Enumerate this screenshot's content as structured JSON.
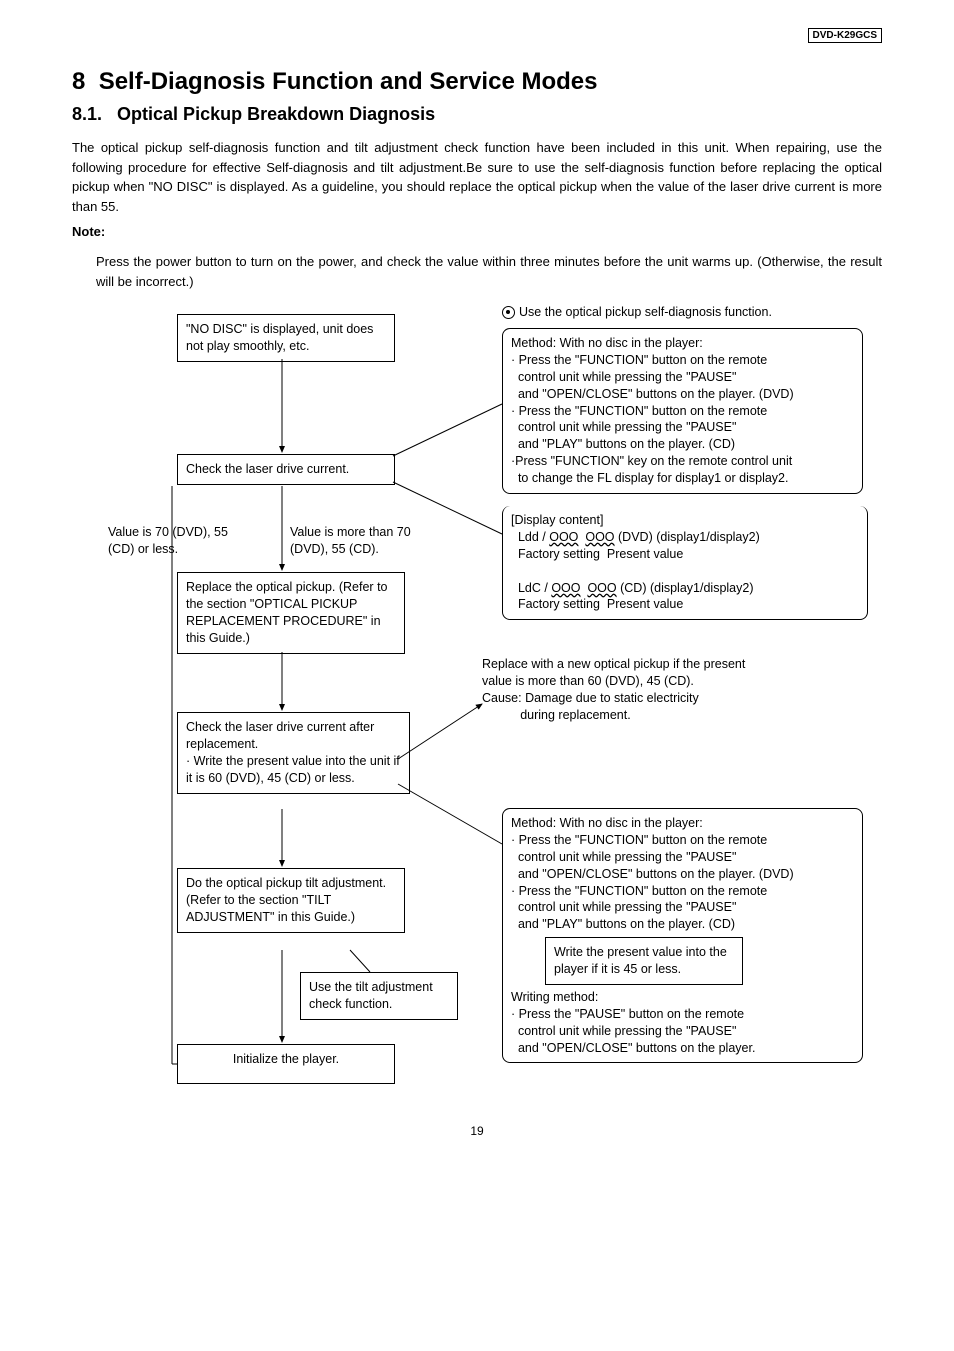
{
  "header": {
    "model": "DVD-K29GCS",
    "section_num": "8",
    "section_title": "Self-Diagnosis Function and Service Modes",
    "sub_num": "8.1.",
    "sub_title": "Optical Pickup Breakdown Diagnosis"
  },
  "body": {
    "intro": "The optical pickup self-diagnosis function and tilt adjustment check function have been included in this unit. When repairing, use the following procedure for effective Self-diagnosis and tilt adjustment.Be sure to use the self-diagnosis function before replacing the optical pickup when \"NO DISC\" is displayed. As a guideline, you should replace the optical pickup when the value of the laser drive current is more than 55.",
    "note_label": "Note:",
    "note_text": "Press the power button to turn on the power, and check the value within three minutes before the unit warms up. (Otherwise, the result will be incorrect.)"
  },
  "flow": {
    "box1": "\"NO DISC\" is displayed, unit does not play smoothly, etc.",
    "box2": "Check the laser drive current.",
    "val_low": "Value is 70 (DVD), 55 (CD) or less.",
    "val_high": "Value is more than 70 (DVD), 55 (CD).",
    "box3": "Replace the optical pickup. (Refer to the section \"OPTICAL PICKUP REPLACEMENT PROCEDURE\" in this Guide.)",
    "box4": "Check the laser drive current after replacement.\n· Write the present value into the unit if it is 60 (DVD), 45 (CD) or less.",
    "box5": "Do the optical pickup tilt adjustment. (Refer to the section \"TILT ADJUSTMENT\" in this Guide.)",
    "box5b": "Use the tilt adjustment check function.",
    "box6": "Initialize the player.",
    "use_fn": "Use the optical pickup self-diagnosis function.",
    "method1": {
      "l1": "Method: With no disc in the player:",
      "l2": "Press the \"FUNCTION\" button on the remote",
      "l3": "control unit while pressing the \"PAUSE\"",
      "l4": "and \"OPEN/CLOSE\" buttons on the player. (DVD)",
      "l5": "Press the \"FUNCTION\" button on the remote",
      "l6": "control unit while pressing the \"PAUSE\"",
      "l7": "and \"PLAY\" buttons on the player. (CD)",
      "l8": "Press \"FUNCTION\" key on the remote control unit",
      "l9": "to change the FL display for display1 or display2."
    },
    "display": {
      "title": "Display content",
      "ldd": "Ldd",
      "dvd": "DVD",
      "ldc": "LdC",
      "cd": "CD",
      "d12": "display1/display2",
      "factory": "Factory setting",
      "present": "Present value"
    },
    "replaceif": {
      "l1": "Replace with a new optical pickup if the present",
      "l2": "value is more than 60 (DVD), 45 (CD).",
      "l3": "Cause: Damage due to static electricity",
      "l4": "during replacement."
    },
    "method2": {
      "l1": "Method: With no disc in the player:",
      "l2": "Press the \"FUNCTION\" button on the remote",
      "l3": "control unit while pressing the \"PAUSE\"",
      "l4": "and \"OPEN/CLOSE\" buttons on the player. (DVD)",
      "l5": "Press the \"FUNCTION\" button on the remote",
      "l6": "control unit while pressing the \"PAUSE\"",
      "l7": "and \"PLAY\" buttons on the player. (CD)",
      "writebox": "Write the present value into the player if it is 45 or less.",
      "wm": "Writing method:",
      "l8": "Press the \"PAUSE\" button on the remote",
      "l9": "control unit while pressing the \"PAUSE\"",
      "l10": "and \"OPEN/CLOSE\" buttons on the player."
    }
  },
  "footer": {
    "page": "19"
  }
}
